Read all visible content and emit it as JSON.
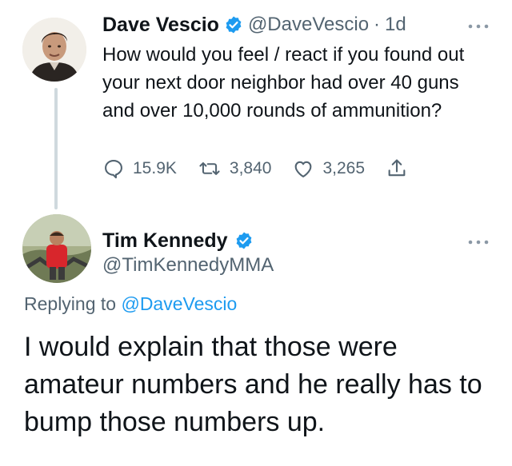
{
  "tweet1": {
    "display_name": "Dave Vescio",
    "handle": "@DaveVescio",
    "separator": "·",
    "time": "1d",
    "text": "How would you feel / react if you found out your next door neighbor had over 40 guns and over 10,000 rounds of ammunition?",
    "replies": "15.9K",
    "retweets": "3,840",
    "likes": "3,265"
  },
  "tweet2": {
    "display_name": "Tim Kennedy",
    "handle": "@TimKennedyMMA",
    "replying_prefix": "Replying to",
    "replying_to": "@DaveVescio",
    "text": "I would explain that those were amateur numbers and he really has to bump those numbers up."
  },
  "colors": {
    "verified": "#1d9bf0",
    "muted": "#536471",
    "link": "#1d9bf0",
    "text": "#0f1419"
  },
  "icons": [
    "more-icon",
    "reply-icon",
    "retweet-icon",
    "like-icon",
    "share-icon",
    "verified-badge-icon"
  ]
}
